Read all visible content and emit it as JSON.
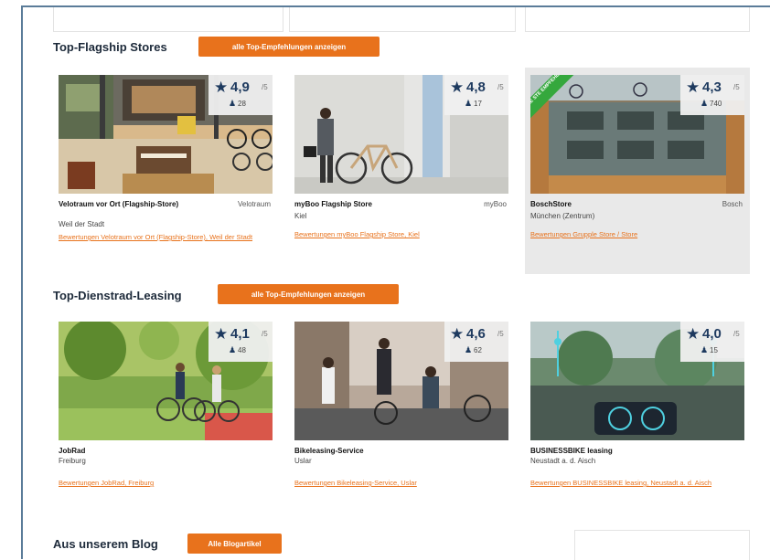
{
  "sections": {
    "flagship": {
      "title": "Top-Flagship Stores",
      "button": "alle Top-Empfehlungen anzeigen",
      "cards": [
        {
          "score": "4,9",
          "of": "/5",
          "count": "28",
          "name": "Velotraum vor Ort (Flagship-Store)",
          "brand": "Velotraum",
          "location": "Weil der Stadt",
          "link": "Bewertungen Velotraum vor Ort (Flagship-Store), Weil der Stadt"
        },
        {
          "score": "4,8",
          "of": "/5",
          "count": "17",
          "name": "myBoo Flagship Store",
          "brand": "myBoo",
          "location": "Kiel",
          "link": "Bewertungen myBoo Flagship Store, Kiel"
        },
        {
          "score": "4,3",
          "of": "/5",
          "count": "740",
          "name": "BoschStore",
          "brand": "Bosch",
          "location": "München (Zentrum)",
          "link": "Bewertungen Grupple Store / Store",
          "badge": "UNE STE EMPFEHLUNG"
        }
      ]
    },
    "leasing": {
      "title": "Top-Dienstrad-Leasing",
      "button": "alle Top-Empfehlungen anzeigen",
      "cards": [
        {
          "score": "4,1",
          "of": "/5",
          "count": "48",
          "name": "JobRad",
          "brand": "",
          "location": "Freiburg",
          "link": "Bewertungen JobRad, Freiburg"
        },
        {
          "score": "4,6",
          "of": "/5",
          "count": "62",
          "name": "Bikeleasing-Service",
          "brand": "",
          "location": "Uslar",
          "link": "Bewertungen Bikeleasing-Service, Uslar"
        },
        {
          "score": "4,0",
          "of": "/5",
          "count": "15",
          "name": "BUSINESSBIKE leasing",
          "brand": "",
          "location": "Neustadt a. d. Aisch",
          "link": "Bewertungen BUSINESSBIKE leasing, Neustadt a. d. Aisch"
        }
      ]
    },
    "blog": {
      "title": "Aus unserem Blog",
      "button": "Alle Blogartikel"
    }
  },
  "icons": {
    "rating": "star-icon",
    "reviews": "person-icon"
  },
  "colors": {
    "accent": "#e8721c",
    "rating": "#1e3a5f",
    "badge": "#35a83d"
  }
}
